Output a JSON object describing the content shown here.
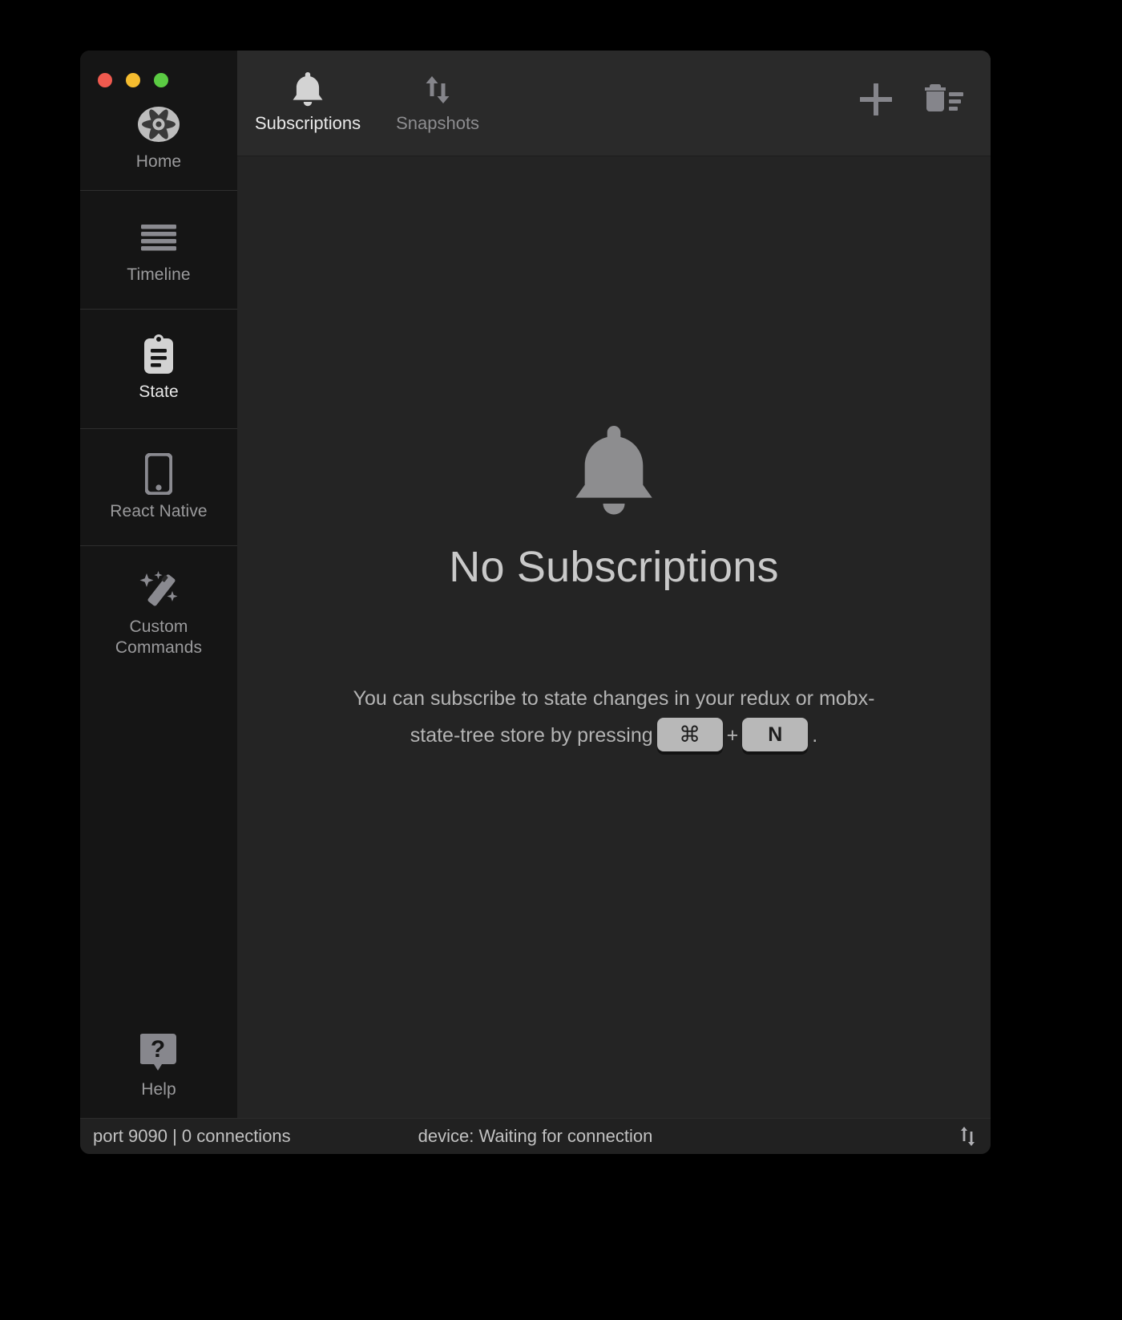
{
  "window": {
    "traffic_lights": [
      {
        "name": "close",
        "color": "#f05a4f"
      },
      {
        "name": "minimize",
        "color": "#f5bc2f"
      },
      {
        "name": "zoom",
        "color": "#5bcb43"
      }
    ]
  },
  "sidebar": {
    "items": [
      {
        "id": "home",
        "label": "Home",
        "icon": "reactotron-logo-icon",
        "active": false
      },
      {
        "id": "timeline",
        "label": "Timeline",
        "icon": "list-lines-icon",
        "active": false
      },
      {
        "id": "state",
        "label": "State",
        "icon": "clipboard-icon",
        "active": true
      },
      {
        "id": "react-native",
        "label": "React Native",
        "icon": "phone-icon",
        "active": false
      },
      {
        "id": "custom-commands",
        "label": "Custom\nCommands",
        "icon": "magic-wand-icon",
        "active": false
      }
    ],
    "help": {
      "id": "help",
      "label": "Help",
      "icon": "question-bubble-icon"
    }
  },
  "toolbar": {
    "tabs": [
      {
        "id": "subscriptions",
        "label": "Subscriptions",
        "icon": "bell-icon",
        "active": true
      },
      {
        "id": "snapshots",
        "label": "Snapshots",
        "icon": "up-down-arrows-icon",
        "active": false
      }
    ],
    "actions": [
      {
        "id": "add",
        "label": "Add subscription",
        "icon": "plus-icon"
      },
      {
        "id": "clear-all",
        "label": "Clear all",
        "icon": "trash-list-icon"
      }
    ]
  },
  "empty_state": {
    "icon": "bell-icon",
    "title": "No Subscriptions",
    "description_part1": "You can subscribe to state changes in your redux or mobx-state-tree store by pressing",
    "key1": "⌘",
    "plus": "+",
    "key2": "N",
    "period": "."
  },
  "statusbar": {
    "left": "port 9090 | 0 connections",
    "center": "device: Waiting for connection",
    "right_icon": "up-down-arrows-icon"
  },
  "colors": {
    "window_bg": "#1b1b1b",
    "sidebar_bg": "#151515",
    "main_bg": "#242424",
    "toolbar_bg": "#2a2a2a",
    "statusbar_bg": "#212121",
    "accent_active": "#e9e9e9",
    "muted": "#8d8d90"
  }
}
